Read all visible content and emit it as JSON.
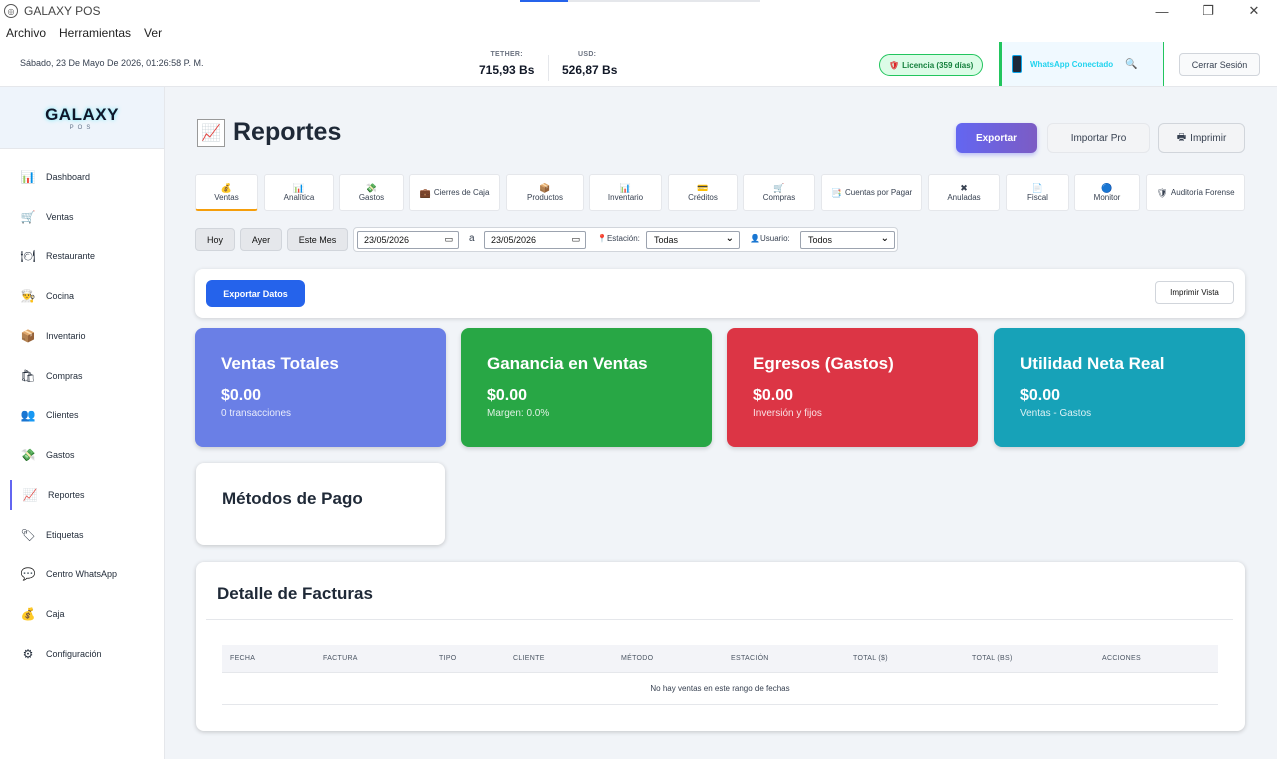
{
  "window": {
    "title": "GALAXY POS",
    "progress_fraction": 0.2
  },
  "menu": [
    "Archivo",
    "Herramientas",
    "Ver"
  ],
  "topbar": {
    "datetime": "Sábado, 23 De Mayo De 2026, 01:26:58 P. M.",
    "rates": [
      {
        "label": "TETHER:",
        "value": "715,93 Bs"
      },
      {
        "label": "USD:",
        "value": "526,87 Bs"
      }
    ],
    "license": "Licencia (359 días)",
    "whatsapp": "WhatsApp Conectado",
    "logout": "Cerrar Sesión"
  },
  "sidebar": {
    "logo": "GALAXY",
    "logo_sub": "POS",
    "items": [
      {
        "label": "Dashboard",
        "icon": "bar-chart-icon"
      },
      {
        "label": "Ventas",
        "icon": "cart-icon"
      },
      {
        "label": "Restaurante",
        "icon": "restaurant-icon"
      },
      {
        "label": "Cocina",
        "icon": "chef-icon"
      },
      {
        "label": "Inventario",
        "icon": "box-icon"
      },
      {
        "label": "Compras",
        "icon": "shopping-bags-icon"
      },
      {
        "label": "Clientes",
        "icon": "users-icon"
      },
      {
        "label": "Gastos",
        "icon": "money-icon"
      },
      {
        "label": "Reportes",
        "icon": "trend-chart-icon"
      },
      {
        "label": "Etiquetas",
        "icon": "tag-icon"
      },
      {
        "label": "Centro WhatsApp",
        "icon": "chat-icon"
      },
      {
        "label": "Caja",
        "icon": "money-bag-icon"
      },
      {
        "label": "Configuración",
        "icon": "gear-icon"
      }
    ],
    "active_index": 8
  },
  "page": {
    "title": "Reportes"
  },
  "actions": {
    "export": "Exportar",
    "import": "Importar Pro",
    "print": "Imprimir"
  },
  "tabs": [
    {
      "label": "Ventas",
      "icon": "💰"
    },
    {
      "label": "Analítica",
      "icon": "📊"
    },
    {
      "label": "Gastos",
      "icon": "💸"
    },
    {
      "label": "Cierres de Caja",
      "icon": "💼"
    },
    {
      "label": "Productos",
      "icon": "📦"
    },
    {
      "label": "Inventario",
      "icon": "📊"
    },
    {
      "label": "Créditos",
      "icon": "💳"
    },
    {
      "label": "Compras",
      "icon": "🛒"
    },
    {
      "label": "Cuentas por Pagar",
      "icon": "📑"
    },
    {
      "label": "Anuladas",
      "icon": "✖"
    },
    {
      "label": "Fiscal",
      "icon": "📄"
    },
    {
      "label": "Monitor",
      "icon": "🔵"
    },
    {
      "label": "Auditoría Forense",
      "icon": "🛡"
    }
  ],
  "filters": {
    "quick": [
      "Hoy",
      "Ayer",
      "Este Mes"
    ],
    "from": "23/05/2026",
    "to_label": "a",
    "to": "23/05/2026",
    "station_label": "Estación:",
    "station": "Todas",
    "user_label": "Usuario:",
    "user": "Todos"
  },
  "export_bar": {
    "export_data": "Exportar Datos",
    "print_view": "Imprimir Vista"
  },
  "cards": [
    {
      "title": "Ventas Totales",
      "value": "$0.00",
      "sub": "0 transacciones",
      "color": "#6a7fe6"
    },
    {
      "title": "Ganancia en Ventas",
      "value": "$0.00",
      "sub": "Margen: 0.0%",
      "color": "#28a745"
    },
    {
      "title": "Egresos (Gastos)",
      "value": "$0.00",
      "sub": "Inversión y fijos",
      "color": "#dc3545"
    },
    {
      "title": "Utilidad Neta Real",
      "value": "$0.00",
      "sub": "Ventas - Gastos",
      "color": "#17a2b8"
    }
  ],
  "payment_methods": {
    "title": "Métodos de Pago"
  },
  "invoices": {
    "title": "Detalle de Facturas",
    "columns": [
      "FECHA",
      "FACTURA",
      "TIPO",
      "CLIENTE",
      "MÉTODO",
      "ESTACIÓN",
      "TOTAL ($)",
      "TOTAL (BS)",
      "ACCIONES"
    ],
    "empty": "No hay ventas en este rango de fechas"
  }
}
